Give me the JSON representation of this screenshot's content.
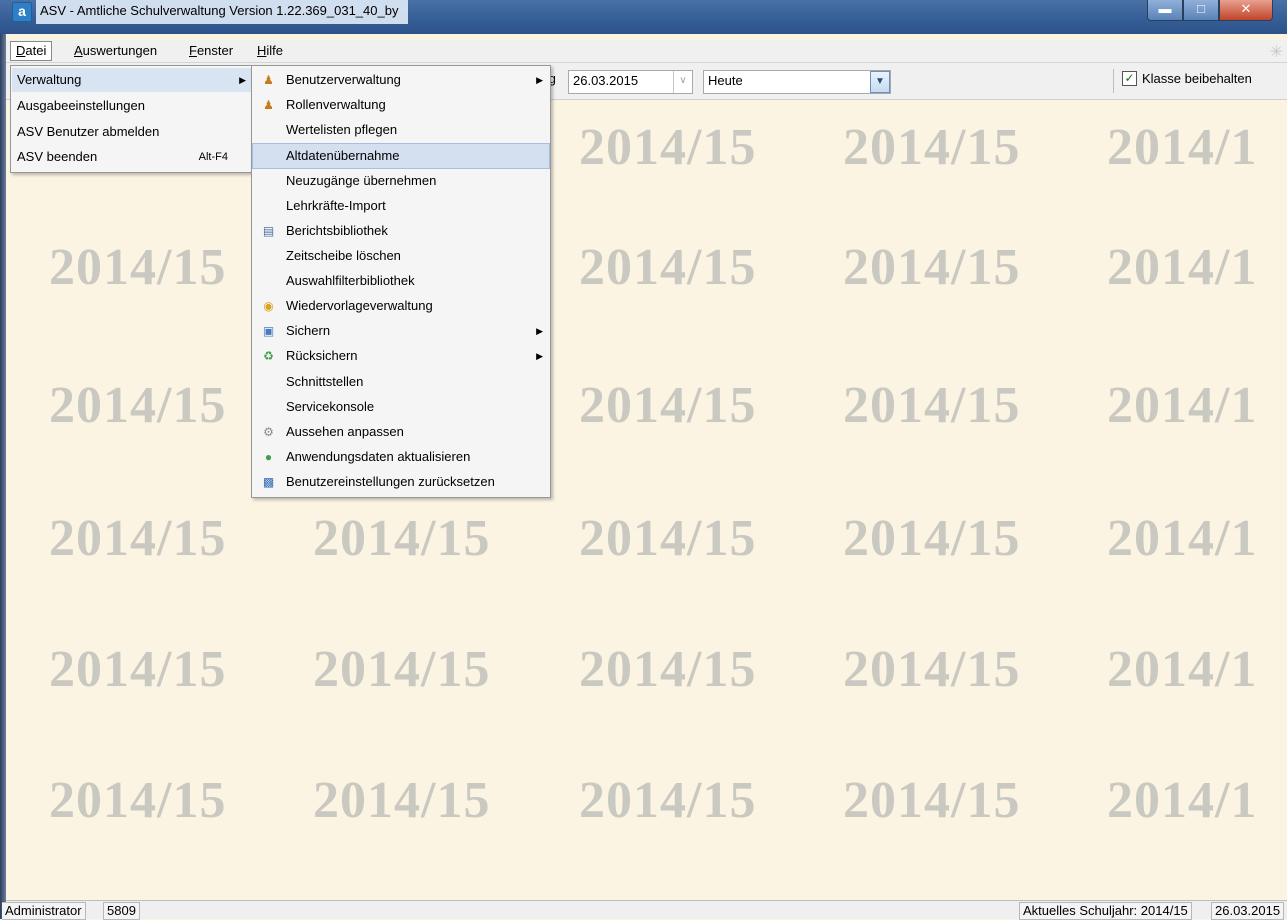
{
  "window": {
    "icon_letter": "a",
    "title": "ASV - Amtliche Schulverwaltung Version 1.22.369_031_40_by",
    "controls": [
      "minimize",
      "maximize",
      "close"
    ]
  },
  "menubar": {
    "items": [
      "Datei",
      "Auswertungen",
      "Fenster",
      "Hilfe"
    ],
    "active": "Datei"
  },
  "toolbar": {
    "date_label_fragment": "ıg",
    "date_value": "26.03.2015",
    "period_value": "Heute",
    "keep_class_label": "Klasse beibehalten",
    "keep_class_checked": true
  },
  "watermark": {
    "text": "2014/15",
    "partial_text": "2014/1",
    "color": "#c9c9c2"
  },
  "datei_menu": {
    "items": [
      {
        "label": "Verwaltung",
        "submenu": true
      },
      {
        "label": "Ausgabeeinstellungen"
      },
      {
        "label": "ASV Benutzer abmelden"
      },
      {
        "label": "ASV beenden",
        "accel": "Alt-F4"
      }
    ]
  },
  "verwaltung_menu": {
    "items": [
      {
        "label": "Benutzerverwaltung",
        "icon": "users-icon",
        "submenu": true
      },
      {
        "label": "Rollenverwaltung",
        "icon": "roles-icon"
      },
      {
        "label": "Wertelisten pflegen"
      },
      {
        "label": "Altdatenübernahme",
        "highlighted": true
      },
      {
        "label": "Neuzugänge übernehmen"
      },
      {
        "label": "Lehrkräfte-Import"
      },
      {
        "label": "Berichtsbibliothek",
        "icon": "report-library-icon"
      },
      {
        "label": "Zeitscheibe löschen"
      },
      {
        "label": "Auswahlfilterbibliothek"
      },
      {
        "label": "Wiedervorlageverwaltung",
        "icon": "bell-icon"
      },
      {
        "label": "Sichern",
        "icon": "save-icon",
        "submenu": true
      },
      {
        "label": "Rücksichern",
        "icon": "restore-icon",
        "submenu": true
      },
      {
        "label": "Schnittstellen"
      },
      {
        "label": "Servicekonsole"
      },
      {
        "label": "Aussehen anpassen",
        "icon": "gear-icon"
      },
      {
        "label": "Anwendungsdaten aktualisieren",
        "icon": "refresh-globe-icon"
      },
      {
        "label": "Benutzereinstellungen zurücksetzen",
        "icon": "reset-settings-icon"
      }
    ]
  },
  "statusbar": {
    "user": "Administrator",
    "school_number": "5809",
    "current_year": "Aktuelles Schuljahr: 2014/15",
    "date": "26.03.2015"
  }
}
